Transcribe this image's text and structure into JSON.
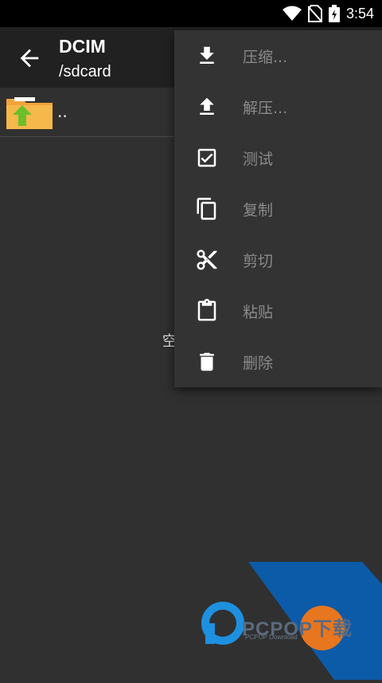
{
  "status": {
    "time": "3:54"
  },
  "toolbar": {
    "title": "DCIM",
    "subtitle": "/sdcard"
  },
  "list": {
    "parent_label": "..",
    "empty_text": "空"
  },
  "menu": {
    "items": [
      {
        "label": "压缩...",
        "icon": "download-icon"
      },
      {
        "label": "解压...",
        "icon": "upload-icon"
      },
      {
        "label": "测试",
        "icon": "checkbox-icon"
      },
      {
        "label": "复制",
        "icon": "copy-icon"
      },
      {
        "label": "剪切",
        "icon": "scissors-icon"
      },
      {
        "label": "粘贴",
        "icon": "clipboard-icon"
      },
      {
        "label": "删除",
        "icon": "trash-icon"
      }
    ]
  },
  "watermark": {
    "text": "PCPOP下载",
    "sub": "PCPOP Download"
  },
  "colors": {
    "background": "#303030",
    "toolbar": "#212121",
    "menu": "#333333",
    "folder": "#F2A33A",
    "arrow": "#6BBF2A",
    "watermark_blue": "#0B5BA8"
  }
}
